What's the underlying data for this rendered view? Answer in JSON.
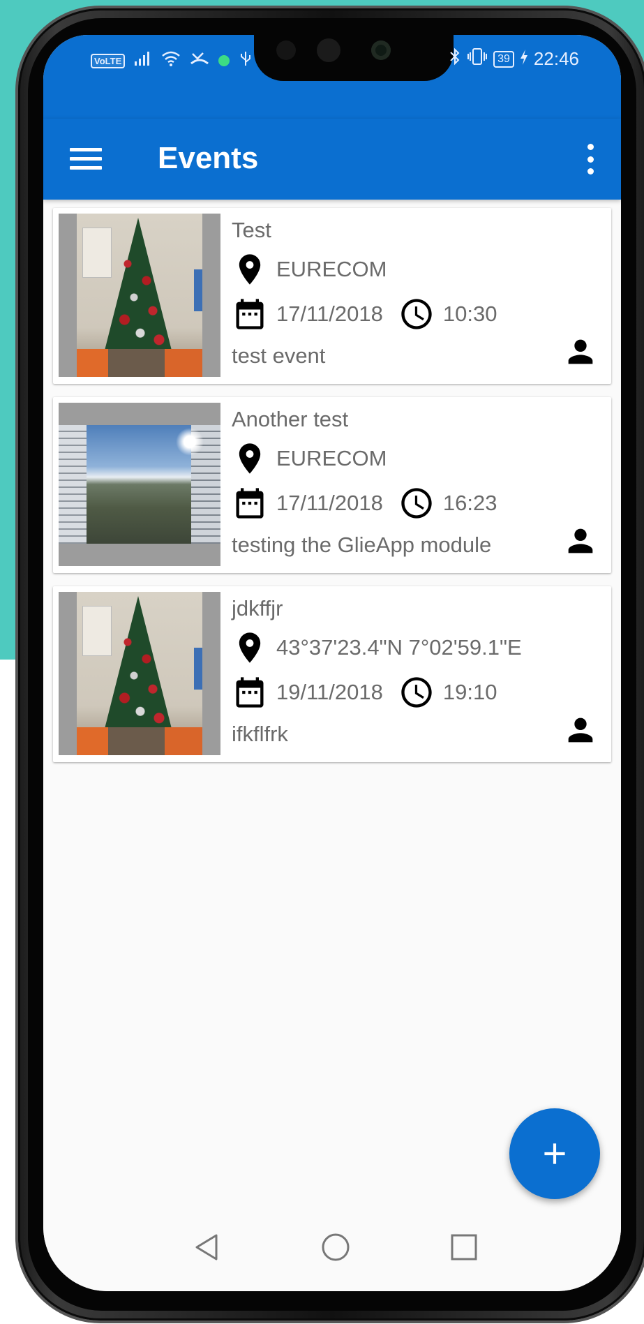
{
  "status_bar": {
    "network_badge": "VoLTE",
    "battery_level": "39",
    "time": "22:46",
    "icons": [
      "signal-icon",
      "wifi-icon",
      "missed-call-icon",
      "app-notification-icon",
      "usb-icon",
      "bluetooth-icon",
      "vibrate-icon",
      "battery-icon",
      "charging-icon"
    ]
  },
  "app_bar": {
    "title": "Events",
    "menu_icon": "menu-icon",
    "more_icon": "more-vert-icon"
  },
  "events": [
    {
      "title": "Test",
      "location": "EURECOM",
      "date": "17/11/2018",
      "time": "10:30",
      "description": "test event",
      "image": "christmas-tree-photo"
    },
    {
      "title": "Another test",
      "location": "EURECOM",
      "date": "17/11/2018",
      "time": "16:23",
      "description": "testing the GlieApp module",
      "image": "campus-photo"
    },
    {
      "title": "jdkffjr",
      "location": "43°37'23.4\"N 7°02'59.1\"E",
      "date": "19/11/2018",
      "time": "19:10",
      "description": "ifkflfrk",
      "image": "christmas-tree-photo"
    }
  ],
  "fab": {
    "icon": "add-icon"
  },
  "colors": {
    "primary": "#0b6fd0",
    "background_teal": "#4ecabf",
    "text_secondary": "#6a6a6a",
    "card": "#ffffff"
  },
  "nav": {
    "icons": [
      "back-icon",
      "home-icon",
      "recents-icon"
    ]
  }
}
